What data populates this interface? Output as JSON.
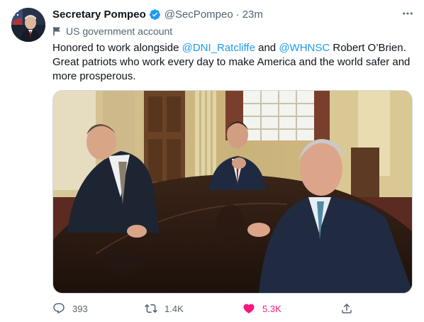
{
  "author": {
    "display_name": "Secretary Pompeo",
    "handle": "@SecPompeo",
    "separator": "·",
    "time": "23m",
    "verified": true,
    "label": "US government account"
  },
  "tweet": {
    "text_parts": [
      "Honored to work alongside ",
      "@DNI_Ratcliffe",
      " and ",
      "@WHNSC",
      " Robert O’Brien. Great patriots who work every day to make America and the world safer and more prosperous."
    ]
  },
  "metrics": {
    "replies": "393",
    "retweets": "1.4K",
    "likes": "5.3K"
  },
  "colors": {
    "accent": "#1d9bf0",
    "like": "#f91880",
    "muted": "#536471"
  },
  "icons": [
    "verified-badge-icon",
    "more-icon",
    "flag-icon",
    "reply-icon",
    "retweet-icon",
    "heart-icon",
    "share-icon"
  ]
}
